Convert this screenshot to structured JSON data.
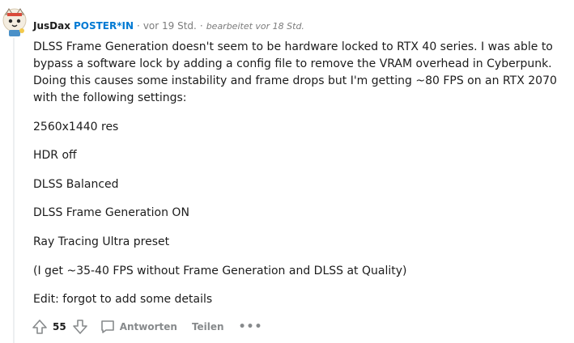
{
  "comment": {
    "author": "JusDax",
    "flair": "POSTER*IN",
    "time": "vor 19 Std.",
    "edited": "bearbeitet vor 18 Std.",
    "paragraphs": [
      "DLSS Frame Generation doesn't seem to be hardware locked to RTX 40 series. I was able to bypass a software lock by adding a config file to remove the VRAM overhead in Cyberpunk. Doing this causes some instability and frame drops but I'm getting ~80 FPS on an RTX 2070 with the following settings:",
      "2560x1440 res",
      "HDR off",
      "DLSS Balanced",
      "DLSS Frame Generation ON",
      "Ray Tracing Ultra preset",
      "(I get ~35-40 FPS without Frame Generation and DLSS at Quality)",
      "Edit: forgot to add some details"
    ]
  },
  "actions": {
    "score": "55",
    "reply_label": "Antworten",
    "share_label": "Teilen",
    "more_label": "•••"
  },
  "colors": {
    "flair": "#0079d3",
    "muted": "#7c7c7c",
    "thread": "#edeff1"
  },
  "icons": [
    "avatar",
    "upvote-icon",
    "downvote-icon",
    "comment-icon",
    "more-icon"
  ]
}
